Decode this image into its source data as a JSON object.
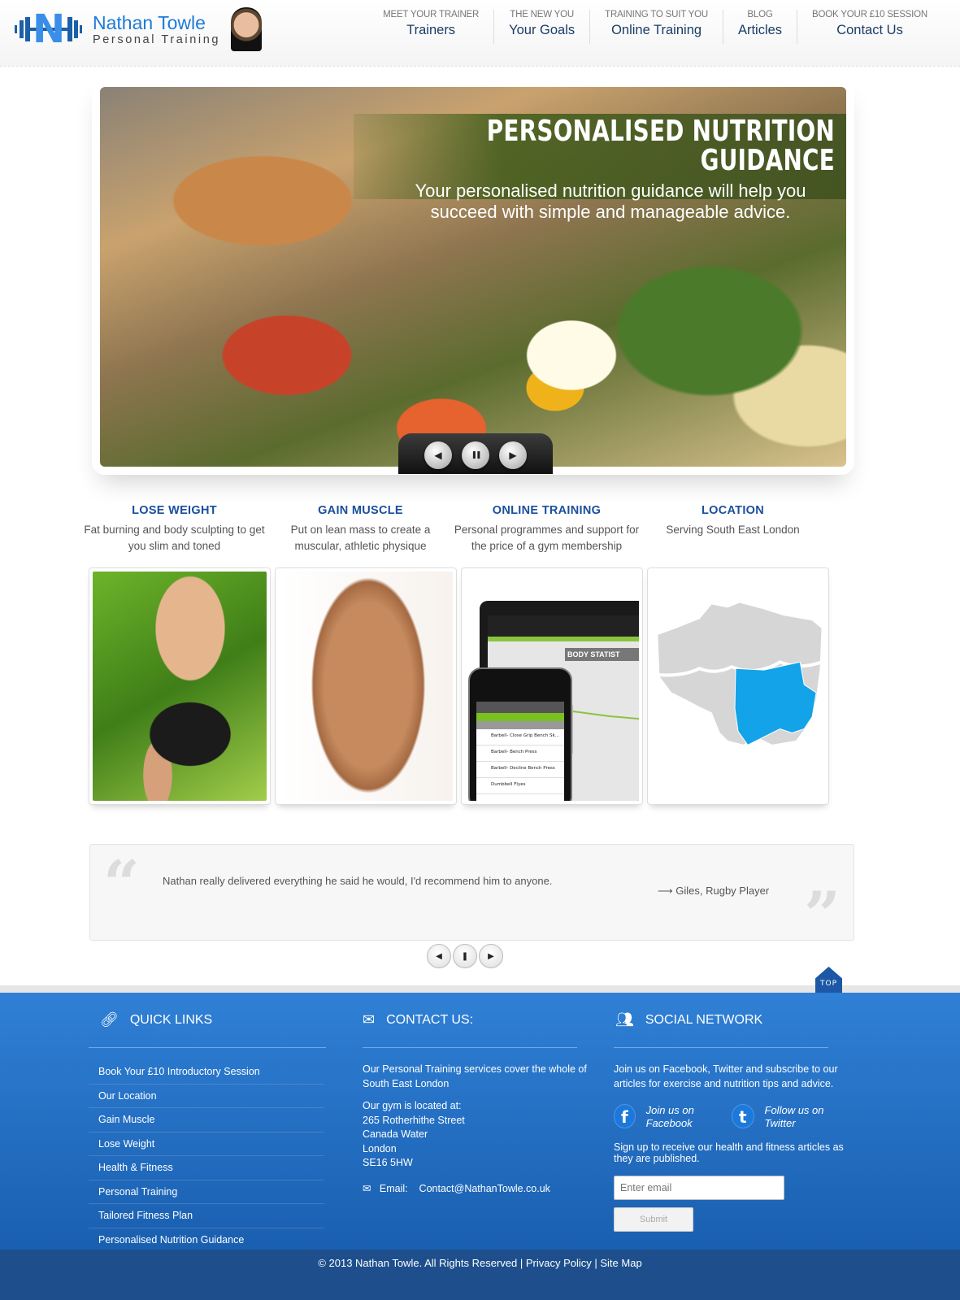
{
  "brand": {
    "name": "Nathan Towle",
    "tagline": "Personal Training",
    "logo_letter": "N"
  },
  "nav": [
    {
      "top": "MEET YOUR TRAINER",
      "label": "Trainers"
    },
    {
      "top": "THE NEW YOU",
      "label": "Your Goals"
    },
    {
      "top": "TRAINING TO SUIT YOU",
      "label": "Online Training"
    },
    {
      "top": "BLOG",
      "label": "Articles"
    },
    {
      "top": "BOOK YOUR £10 SESSION",
      "label": "Contact Us"
    }
  ],
  "hero": {
    "title": "PERSONALISED NUTRITION GUIDANCE",
    "text": "Your personalised nutrition guidance will help you succeed with simple and manageable advice.",
    "controls": {
      "prev": "◀",
      "pause": "❚❚",
      "next": "▶"
    }
  },
  "features": [
    {
      "title": "LOSE WEIGHT",
      "desc": "Fat burning and body sculpting to get you slim and toned"
    },
    {
      "title": "GAIN MUSCLE",
      "desc": "Put on lean mass to create a muscular, athletic physique"
    },
    {
      "title": "ONLINE TRAINING",
      "desc": "Personal programmes and support for the price of a gym membership"
    },
    {
      "title": "LOCATION",
      "desc": "Serving South East London"
    }
  ],
  "online_mockup": {
    "phone_rows": [
      "Barbell- Close Grip Bench Sk...",
      "Barbell- Bench Press",
      "Barbell- Decline Bench Press",
      "Dumbbell Flyes"
    ],
    "laptop_heading": "BODY STATIST"
  },
  "testimonial": {
    "quote": "Nathan really delivered everything he said he would, I'd recommend him to anyone.",
    "author": "Giles, Rugby Player",
    "arrow": "⟶",
    "controls": {
      "prev": "◀",
      "pause": "❚",
      "next": "▶"
    }
  },
  "top_button": "TOP",
  "footer": {
    "quick_links": {
      "heading": "QUICK LINKS",
      "icon": "link-icon",
      "items": [
        "Book Your £10 Introductory Session",
        "Our Location",
        "Gain Muscle",
        "Lose Weight",
        "Health & Fitness",
        "Personal Training",
        "Tailored Fitness Plan",
        "Personalised Nutrition Guidance"
      ]
    },
    "contact": {
      "heading": "CONTACT US:",
      "icon": "envelope-icon",
      "intro": "Our Personal Training services cover the whole of South East London",
      "address_label": "Our gym is located at:",
      "address": [
        "265 Rotherhithe Street",
        "Canada Water",
        "London",
        "SE16 5HW"
      ],
      "email_label": "Email:",
      "email": "Contact@NathanTowle.co.uk"
    },
    "social": {
      "heading": "SOCIAL NETWORK",
      "icon": "people-icon",
      "intro": "Join us on Facebook, Twitter and subscribe to our articles for exercise and nutrition tips and advice.",
      "facebook": "Join us on Facebook",
      "twitter": "Follow us on Twitter",
      "signup_text": "Sign up to receive our health and fitness articles as they are published.",
      "email_placeholder": "Enter email",
      "submit": "Submit"
    }
  },
  "copyright": {
    "text": "© 2013 Nathan Towle. All Rights Reserved",
    "privacy": "Privacy Policy",
    "sitemap": "Site Map",
    "sep": " | "
  },
  "colors": {
    "brand_blue": "#1d7bd8",
    "nav_dark": "#1a3d66",
    "feature_title": "#1a4f9c",
    "footer_blue": "#2f80d6",
    "footer_bottom": "#1e4f8c",
    "map_highlight": "#12a3e8"
  }
}
